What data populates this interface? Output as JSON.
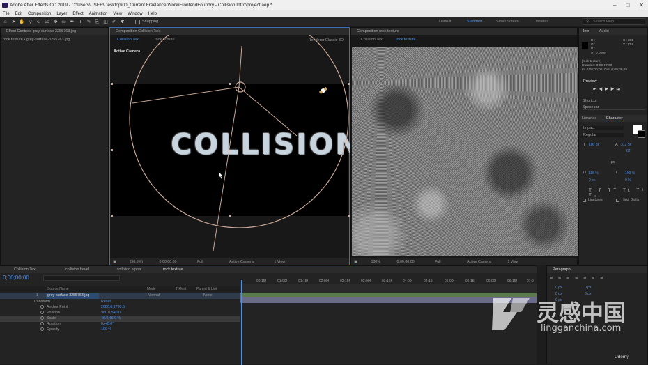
{
  "window": {
    "title": "Adobe After Effects CC 2019 - C:\\Users\\USER\\Desktop\\00_Current Freelance Work\\FrontendFoundry - Collision Intro\\project.aep *",
    "minimize": "–",
    "maximize": "□",
    "close": "✕"
  },
  "menu": [
    "File",
    "Edit",
    "Composition",
    "Layer",
    "Effect",
    "Animation",
    "View",
    "Window",
    "Help"
  ],
  "toolbar": {
    "snapping_label": "Snapping"
  },
  "workspaces": {
    "default": "Default",
    "standard": "Standard",
    "small_screen": "Small Screen",
    "libraries": "Libraries"
  },
  "search": {
    "placeholder": "Search Help"
  },
  "effect_controls": {
    "title": "Effect Controls grey-surface-3255763.jpg",
    "layer": "rock texture • grey-surface-3255763.jpg"
  },
  "comp_left": {
    "title": "Composition Collision Text",
    "tabs": [
      "Collision Text",
      "rock texture"
    ],
    "renderer_label": "Renderer:",
    "renderer_value": "Classic 3D",
    "camera_label": "Active Camera",
    "main_text": "COLLISION",
    "bar": {
      "zoom": "(36.5%)",
      "timecode": "0;00;00;00",
      "quality": "Full",
      "camera": "Active Camera",
      "view": "1 View"
    }
  },
  "comp_right": {
    "title": "Composition rock texture",
    "tabs": [
      "Collision Text",
      "rock texture"
    ],
    "bar": {
      "zoom": "100%",
      "timecode": "0;00;00;00",
      "quality": "Full",
      "camera": "Active Camera",
      "view": "1 View"
    }
  },
  "info": {
    "tabs": [
      "Info",
      "Audio"
    ],
    "r": "R :",
    "g": "G :",
    "b": "B :",
    "a": "A : 0.0000",
    "x": "X : 981",
    "y": "Y : 758",
    "layer_name": "[rock texture]",
    "duration": "Duration: 0;00;07;00",
    "in_out": "In: 0;00;00;00, Out: 0;00;06;29"
  },
  "preview": {
    "title": "Preview"
  },
  "shortcut": {
    "label": "Shortcut",
    "value": "Spacebar"
  },
  "character": {
    "tabs": [
      "Libraries",
      "Character"
    ],
    "font": "Impact",
    "style": "Regular",
    "size": "100 px",
    "leading": "312 px",
    "tracking": "82",
    "kerning": "px",
    "v_scale": "115 %",
    "h_scale": "100 %",
    "baseline": "0 px",
    "tsume": "0 %",
    "ligatures": "Ligatures",
    "hindi": "Hindi Digits"
  },
  "timeline": {
    "tabs": [
      "Collision Text",
      "collision bevel",
      "collision alpha",
      "rock texture"
    ],
    "timecode": "0;00;00;00",
    "search_placeholder": "",
    "headers": {
      "source_name": "Source Name",
      "mode": "Mode",
      "trkmat": "TrkMat",
      "parent": "Parent & Link"
    },
    "layer": {
      "num": "1",
      "name": "grey-surface-3255763.jpg",
      "mode": "Normal",
      "parent": "None"
    },
    "transform": {
      "label": "Transform",
      "reset": "Reset"
    },
    "props": [
      {
        "name": "Anchor Point",
        "value": "2080.0,1730.5"
      },
      {
        "name": "Position",
        "value": "960.0,540.0"
      },
      {
        "name": "Scale",
        "value": "46.0,46.0 %"
      },
      {
        "name": "Rotation",
        "value": "0x+0.0°"
      },
      {
        "name": "Opacity",
        "value": "100 %"
      }
    ],
    "ruler": [
      "00:15f",
      "01:00f",
      "01:15f",
      "02:00f",
      "02:15f",
      "03:00f",
      "03:15f",
      "04:00f",
      "04:15f",
      "05:00f",
      "05:15f",
      "06:00f",
      "06:15f",
      "07:0"
    ]
  },
  "paragraph": {
    "title": "Paragraph",
    "values": [
      "0 px",
      "0 px",
      "0 px",
      "0 px",
      "0 px"
    ]
  },
  "watermark": {
    "chinese": "灵感中国",
    "url": "lingganchina.com",
    "udemy": "Udemy"
  },
  "colors": {
    "accent": "#4e8fe7",
    "selection": "#d0a088",
    "panel": "#232323"
  }
}
